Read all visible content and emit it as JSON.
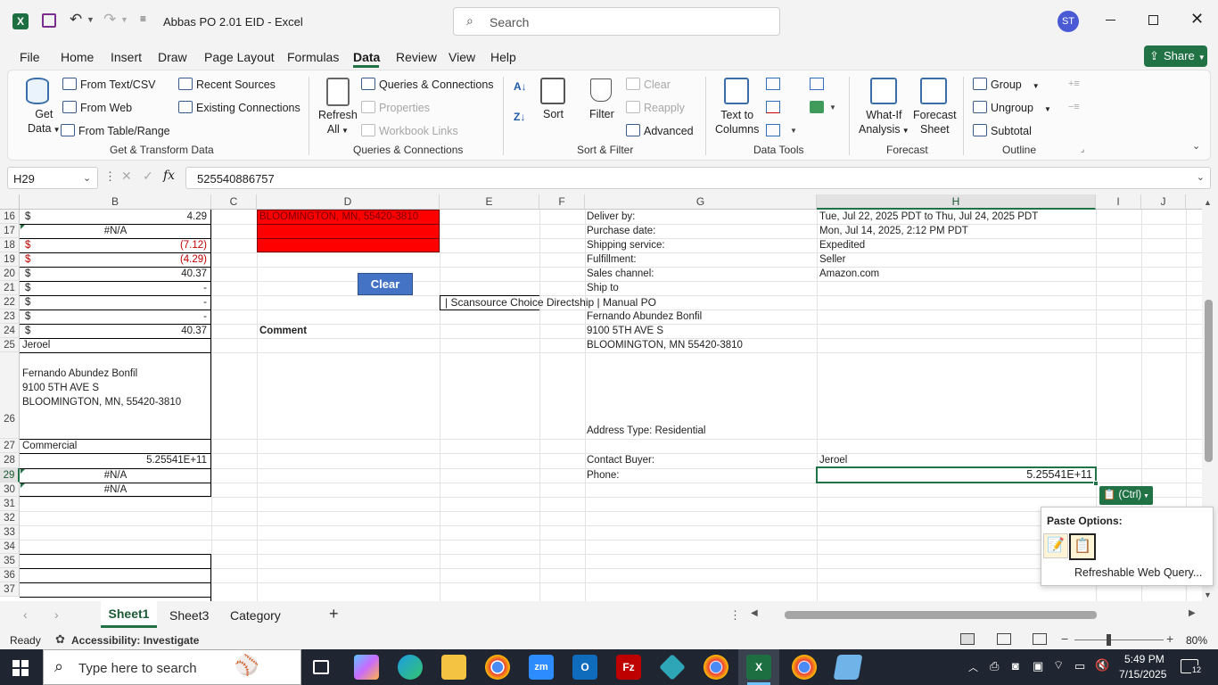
{
  "titlebar": {
    "doc_title": "Abbas PO 2.01 EID  -  Excel",
    "search_placeholder": "Search",
    "avatar": "ST"
  },
  "menu": {
    "items": [
      "File",
      "Home",
      "Insert",
      "Draw",
      "Page Layout",
      "Formulas",
      "Data",
      "Review",
      "View",
      "Help"
    ],
    "active": "Data",
    "share": "Share"
  },
  "ribbon": {
    "get_data": "Get",
    "get_data2": "Data",
    "from_text": "From Text/CSV",
    "from_web": "From Web",
    "from_table": "From Table/Range",
    "recent": "Recent Sources",
    "existing": "Existing Connections",
    "group1": "Get & Transform Data",
    "refresh": "Refresh",
    "refresh2": "All",
    "queries": "Queries & Connections",
    "properties": "Properties",
    "workbook_links": "Workbook Links",
    "group2": "Queries & Connections",
    "sort": "Sort",
    "filter": "Filter",
    "clear": "Clear",
    "reapply": "Reapply",
    "advanced": "Advanced",
    "group3": "Sort & Filter",
    "text_to_columns": "Text to",
    "text_to_columns2": "Columns",
    "group4": "Data Tools",
    "whatif": "What-If",
    "whatif2": "Analysis",
    "forecast": "Forecast",
    "forecast2": "Sheet",
    "group5": "Forecast",
    "group_btn": "Group",
    "ungroup": "Ungroup",
    "subtotal": "Subtotal",
    "group6": "Outline"
  },
  "formula": {
    "namebox": "H29",
    "fx": "fx",
    "value": "525540886757"
  },
  "columns": [
    "B",
    "C",
    "D",
    "E",
    "F",
    "G",
    "H",
    "I",
    "J"
  ],
  "rows": [
    "16",
    "17",
    "18",
    "19",
    "20",
    "21",
    "22",
    "23",
    "24",
    "25",
    "26",
    "27",
    "28",
    "29",
    "30",
    "31",
    "32",
    "33",
    "34",
    "35",
    "36",
    "37"
  ],
  "cells": {
    "b16a": "$",
    "b16": "4.29",
    "b17": "#N/A",
    "b18a": "$",
    "b18": "(7.12)",
    "b19a": "$",
    "b19": "(4.29)",
    "b20a": "$",
    "b20": "40.37",
    "b21a": "$",
    "b21": "-",
    "b22a": "$",
    "b22": "-",
    "b23a": "$",
    "b23": "-",
    "b24a": "$",
    "b24": "40.37",
    "b25": "Jeroel",
    "b26_1": "Fernando Abundez Bonfil",
    "b26_2": "9100 5TH AVE S",
    "b26_3": "BLOOMINGTON, MN, 55420-3810",
    "b27": "Commercial",
    "b28": "5.25541E+11",
    "b29": "#N/A",
    "b30": "#N/A",
    "d16": "BLOOMINGTON, MN, 55420-3810",
    "d24": "Comment",
    "clear_button": "Clear",
    "e22": "| Scansource Choice Directship | Manual PO",
    "g16": "Deliver by:",
    "g17": "Purchase date:",
    "g18": "Shipping service:",
    "g19": "Fulfillment:",
    "g20": "Sales channel:",
    "g21": "Ship to",
    "g23": "Fernando Abundez Bonfil",
    "g24": "9100 5TH AVE S",
    "g25": "BLOOMINGTON, MN 55420-3810",
    "g26": "Address Type:  Residential",
    "g28": "Contact Buyer:",
    "g29": "Phone:",
    "h16": "Tue, Jul 22, 2025 PDT to Thu, Jul 24, 2025 PDT",
    "h17": "Mon, Jul 14, 2025, 2:12 PM PDT",
    "h18": "Expedited",
    "h19": "Seller",
    "h20": "Amazon.com",
    "h28": "Jeroel",
    "h29": "5.25541E+11"
  },
  "paste": {
    "ctrl": "(Ctrl)",
    "title": "Paste Options:",
    "refreshable": "Refreshable Web Query..."
  },
  "sheets": {
    "tabs": [
      "Sheet1",
      "Sheet3",
      "Category"
    ],
    "active": "Sheet1",
    "add": "+"
  },
  "status": {
    "ready": "Ready",
    "accessibility": "Accessibility: Investigate",
    "zoom": "80%"
  },
  "taskbar": {
    "search_placeholder": "Type here to search",
    "time": "5:49 PM",
    "date": "7/15/2025",
    "notifications": "12"
  },
  "colors": {
    "accent": "#217346",
    "red_fill": "#ff0000",
    "negative": "#c00000",
    "clear_btn": "#4472c4"
  }
}
